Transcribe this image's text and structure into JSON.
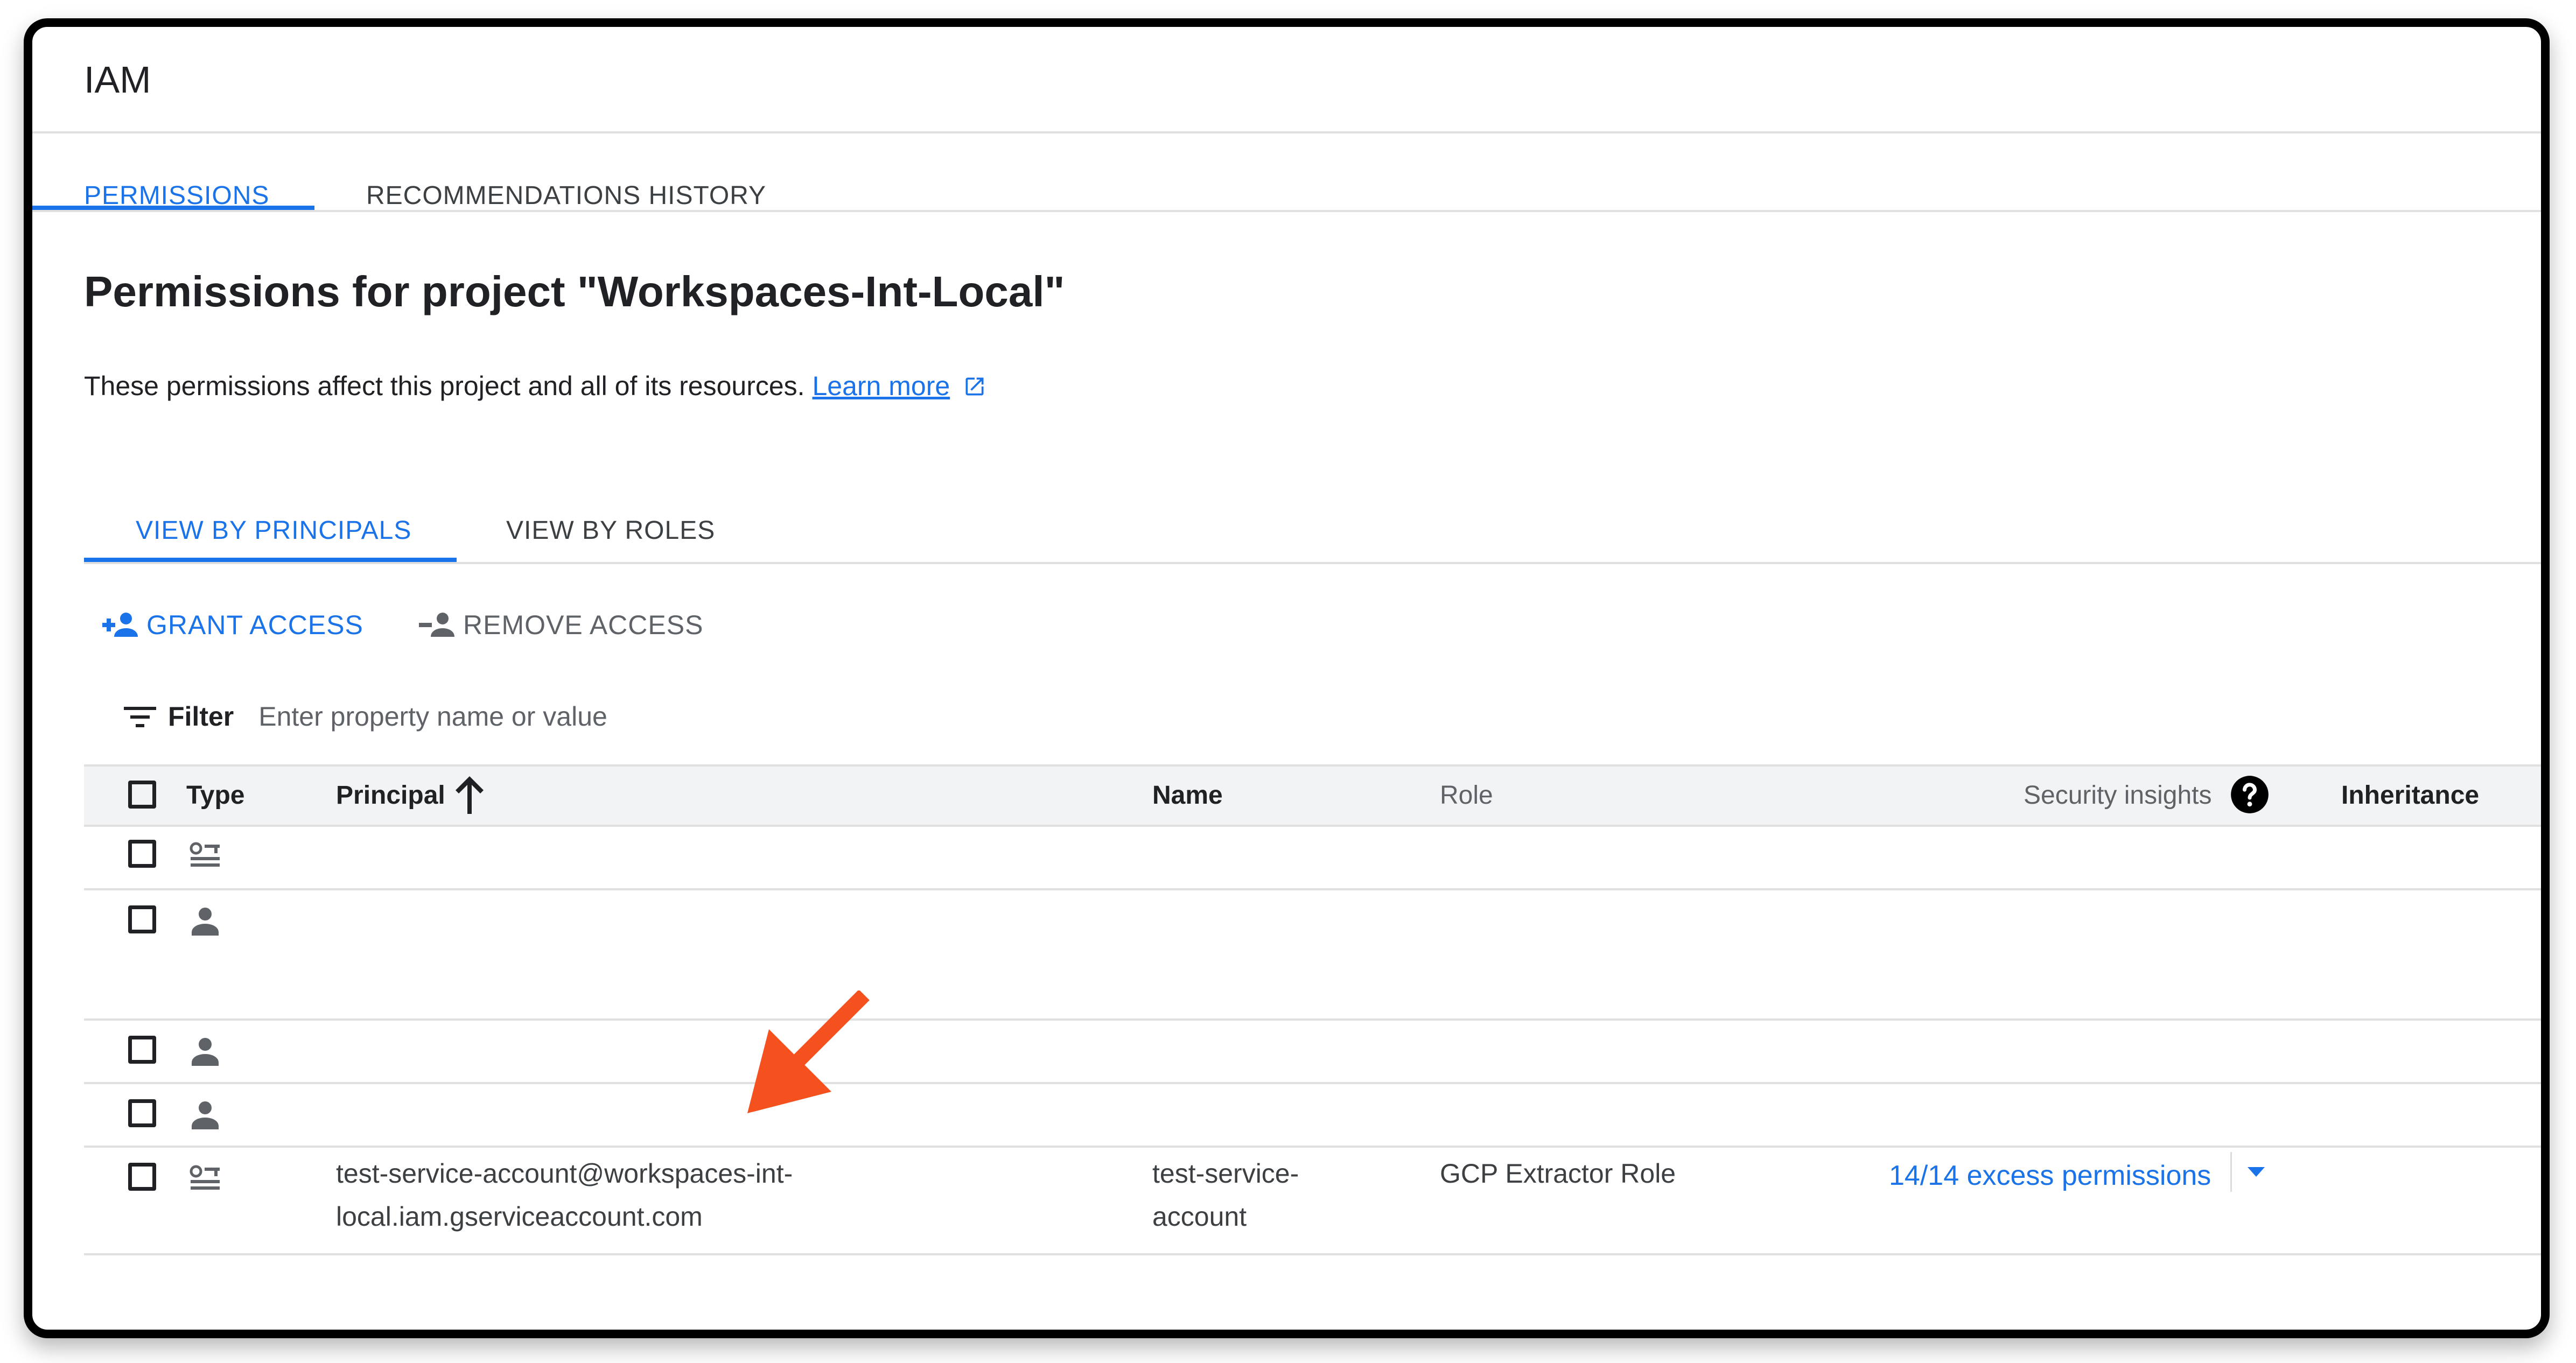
{
  "app": {
    "title": "IAM"
  },
  "top_tabs": [
    {
      "label": "PERMISSIONS",
      "active": true
    },
    {
      "label": "RECOMMENDATIONS HISTORY",
      "active": false
    }
  ],
  "page": {
    "title": "Permissions for project \"Workspaces-Int-Local\"",
    "description": "These permissions affect this project and all of its resources.",
    "learn_more": "Learn more"
  },
  "view_tabs": [
    {
      "label": "VIEW BY PRINCIPALS",
      "active": true
    },
    {
      "label": "VIEW BY ROLES",
      "active": false
    }
  ],
  "actions": {
    "grant": "GRANT ACCESS",
    "remove": "REMOVE ACCESS"
  },
  "filter": {
    "label": "Filter",
    "placeholder": "Enter property name or value"
  },
  "table": {
    "headers": {
      "type": "Type",
      "principal": "Principal",
      "name": "Name",
      "role": "Role",
      "security_insights": "Security insights",
      "inheritance": "Inheritance"
    },
    "rows": [
      {
        "type_icon": "service-account-icon"
      },
      {
        "type_icon": "person-icon"
      },
      {
        "type_icon": "person-icon"
      },
      {
        "type_icon": "person-icon"
      },
      {
        "type_icon": "service-account-icon",
        "principal_line1": "test-service-account@workspaces-int-",
        "principal_line2": "local.iam.gserviceaccount.com",
        "name_line1": "test-service-",
        "name_line2": "account",
        "role": "GCP Extractor Role",
        "insight": "14/14 excess permissions"
      }
    ]
  },
  "colors": {
    "accent": "#1a73e8",
    "annotation_arrow": "#f4511e",
    "header_bg": "#f1f3f4"
  }
}
